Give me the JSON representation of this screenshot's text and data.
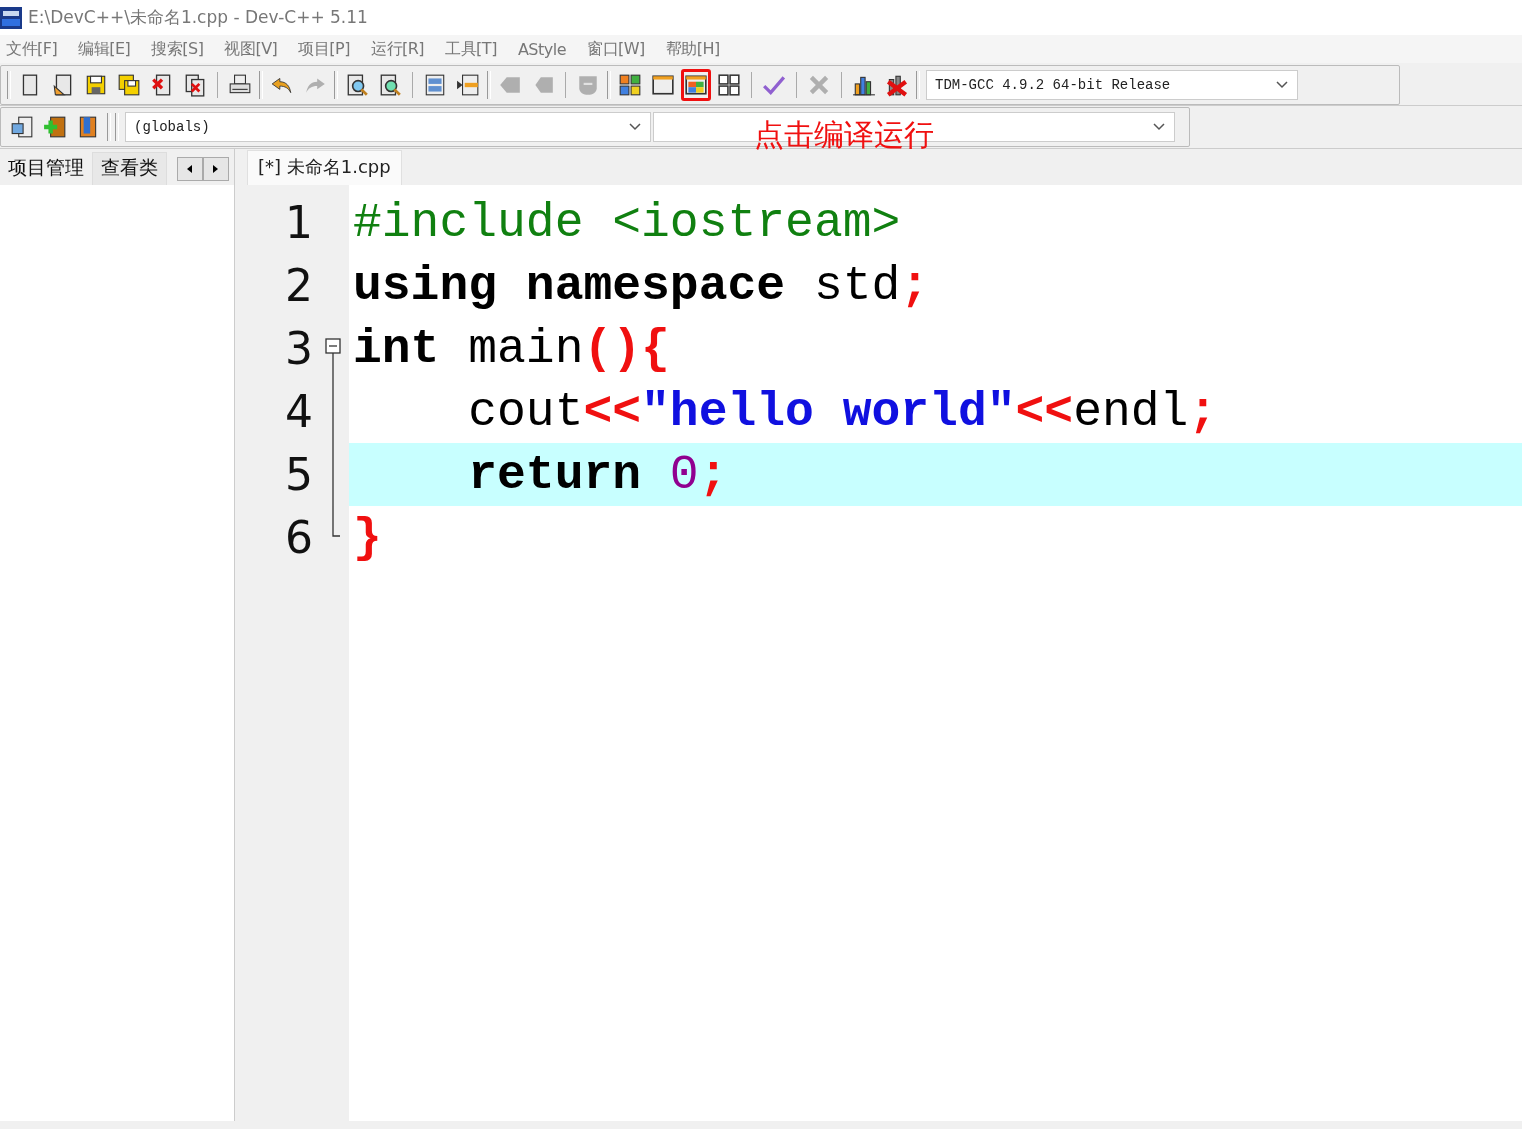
{
  "window": {
    "title": "E:\\DevC++\\未命名1.cpp - Dev-C++ 5.11"
  },
  "menu": [
    "文件[F]",
    "编辑[E]",
    "搜索[S]",
    "视图[V]",
    "项目[P]",
    "运行[R]",
    "工具[T]",
    "AStyle",
    "窗口[W]",
    "帮助[H]"
  ],
  "toolbar": {
    "groups": [
      [
        {
          "kind": "new",
          "disabled": false,
          "highlighted": false
        },
        {
          "kind": "open",
          "disabled": false,
          "highlighted": false
        },
        {
          "kind": "save",
          "disabled": false,
          "highlighted": false
        },
        {
          "kind": "save-all",
          "disabled": false,
          "highlighted": false
        },
        {
          "kind": "close",
          "disabled": false,
          "highlighted": false
        },
        {
          "kind": "close-all",
          "disabled": false,
          "highlighted": false
        },
        {
          "kind": "sep"
        },
        {
          "kind": "print",
          "disabled": false,
          "highlighted": false
        }
      ],
      [
        {
          "kind": "undo",
          "disabled": false,
          "highlighted": false
        },
        {
          "kind": "redo",
          "disabled": true,
          "highlighted": false
        }
      ],
      [
        {
          "kind": "find",
          "disabled": false,
          "highlighted": false
        },
        {
          "kind": "replace",
          "disabled": false,
          "highlighted": false
        },
        {
          "kind": "sep"
        },
        {
          "kind": "indent",
          "disabled": false,
          "highlighted": false
        },
        {
          "kind": "unindent",
          "disabled": false,
          "highlighted": false
        }
      ],
      [
        {
          "kind": "goto-back",
          "disabled": true,
          "highlighted": false
        },
        {
          "kind": "goto-forward",
          "disabled": true,
          "highlighted": false
        },
        {
          "kind": "sep"
        },
        {
          "kind": "bookmark",
          "disabled": true,
          "highlighted": false
        }
      ],
      [
        {
          "kind": "compile",
          "disabled": false,
          "highlighted": false
        },
        {
          "kind": "run",
          "disabled": false,
          "highlighted": false
        },
        {
          "kind": "compile-run",
          "disabled": false,
          "highlighted": true
        },
        {
          "kind": "rebuild",
          "disabled": false,
          "highlighted": false
        },
        {
          "kind": "sep"
        },
        {
          "kind": "check",
          "disabled": false,
          "highlighted": false
        },
        {
          "kind": "sep"
        },
        {
          "kind": "stop",
          "disabled": true,
          "highlighted": false
        },
        {
          "kind": "sep"
        },
        {
          "kind": "chart",
          "disabled": false,
          "highlighted": false
        },
        {
          "kind": "delete",
          "disabled": false,
          "highlighted": false
        }
      ]
    ],
    "compiler": "TDM-GCC 4.9.2 64-bit Release",
    "row2": [
      {
        "kind": "new-project",
        "disabled": false,
        "highlighted": false
      },
      {
        "kind": "add-file",
        "disabled": false,
        "highlighted": false
      },
      {
        "kind": "book",
        "disabled": false,
        "highlighted": false
      }
    ],
    "scope": "(globals)"
  },
  "annotation": "点击编译运行",
  "side_tabs": [
    {
      "label": "项目管理",
      "selected": true
    },
    {
      "label": "查看类",
      "selected": false
    }
  ],
  "editor_tab": "[*] 未命名1.cpp",
  "code": [
    {
      "number": "1",
      "kind": "plain",
      "highlighted": false,
      "tokens": [
        {
          "t": "#include <iostream>",
          "kind": "preprocessor"
        }
      ]
    },
    {
      "number": "2",
      "kind": "plain",
      "highlighted": false,
      "tokens": [
        {
          "t": "using namespace",
          "kind": "keyword"
        },
        {
          "t": " std",
          "kind": "plain"
        },
        {
          "t": ";",
          "kind": "symbol"
        }
      ]
    },
    {
      "number": "3",
      "kind": "fold-start",
      "highlighted": false,
      "tokens": [
        {
          "t": "int",
          "kind": "keyword"
        },
        {
          "t": " main",
          "kind": "plain"
        },
        {
          "t": "(){",
          "kind": "symbol"
        }
      ]
    },
    {
      "number": "4",
      "kind": "fold-body",
      "highlighted": false,
      "tokens": [
        {
          "t": "    cout",
          "kind": "plain"
        },
        {
          "t": "<<",
          "kind": "symbol"
        },
        {
          "t": "\"hello world\"",
          "kind": "string"
        },
        {
          "t": "<<",
          "kind": "symbol"
        },
        {
          "t": "endl",
          "kind": "plain"
        },
        {
          "t": ";",
          "kind": "symbol"
        }
      ]
    },
    {
      "number": "5",
      "kind": "fold-body",
      "highlighted": true,
      "tokens": [
        {
          "t": "    return",
          "kind": "keyword"
        },
        {
          "t": " 0",
          "kind": "number"
        },
        {
          "t": ";",
          "kind": "symbol"
        }
      ]
    },
    {
      "number": "6",
      "kind": "fold-end",
      "highlighted": false,
      "tokens": [
        {
          "t": "}",
          "kind": "symbol"
        }
      ]
    }
  ]
}
